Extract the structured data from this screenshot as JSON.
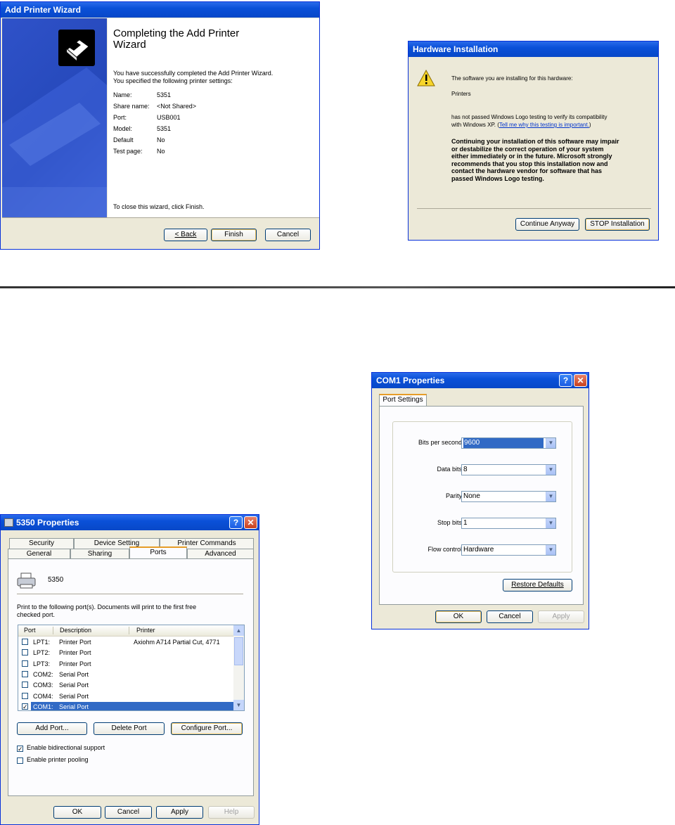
{
  "wizard": {
    "title": "Add Printer Wizard",
    "heading": "Completing the Add Printer Wizard",
    "intro1": "You have successfully completed the Add Printer Wizard.",
    "intro2": "You specified the following printer settings:",
    "settings": [
      {
        "label": "Name:",
        "value": "5351"
      },
      {
        "label": "Share name:",
        "value": "<Not Shared>"
      },
      {
        "label": "Port:",
        "value": "USB001"
      },
      {
        "label": "Model:",
        "value": "5351"
      },
      {
        "label": "Default",
        "value": "No"
      },
      {
        "label": "Test page:",
        "value": "No"
      }
    ],
    "close_text": "To close this wizard, click Finish.",
    "back": "< Back",
    "finish": "Finish",
    "cancel": "Cancel"
  },
  "hw": {
    "title": "Hardware Installation",
    "line1": "The software you are installing for this hardware:",
    "line2": "Printers",
    "line3": "has not passed Windows Logo testing to verify its compatibility",
    "line4_pre": "with Windows XP. (",
    "line4_link": "Tell me why this testing is important.",
    "line4_post": ")",
    "warn": [
      "Continuing your installation of this software may impair",
      "or destabilize the correct operation of your system",
      "either immediately or in the future. Microsoft strongly",
      "recommends that you stop this installation now and",
      "contact the hardware vendor for software that has",
      "passed Windows Logo testing."
    ],
    "continue": "Continue Anyway",
    "stop": "STOP Installation"
  },
  "props": {
    "title": "5350 Properties",
    "tabs_row1": [
      "Security",
      "Device Setting",
      "Printer Commands"
    ],
    "tabs_row2": [
      "General",
      "Sharing",
      "Ports",
      "Advanced"
    ],
    "printer_name": "5350",
    "instr1": "Print to the following port(s). Documents will print to the first free",
    "instr2": "checked port.",
    "cols": [
      "Port",
      "Description",
      "Printer"
    ],
    "ports": [
      {
        "port": "LPT1:",
        "desc": "Printer Port",
        "printer": "Axiohm A714 Partial Cut, 4771"
      },
      {
        "port": "LPT2:",
        "desc": "Printer Port",
        "printer": ""
      },
      {
        "port": "LPT3:",
        "desc": "Printer Port",
        "printer": ""
      },
      {
        "port": "COM2:",
        "desc": "Serial Port",
        "printer": ""
      },
      {
        "port": "COM3:",
        "desc": "Serial Port",
        "printer": ""
      },
      {
        "port": "COM4:",
        "desc": "Serial Port",
        "printer": ""
      },
      {
        "port": "COM1:",
        "desc": "Serial Port",
        "printer": ""
      }
    ],
    "add_port": "Add Port...",
    "delete_port": "Delete Port",
    "configure_port": "Configure Port...",
    "bidi": "Enable bidirectional support",
    "pooling": "Enable printer pooling",
    "ok": "OK",
    "cancel": "Cancel",
    "apply": "Apply",
    "help": "Help"
  },
  "com": {
    "title": "COM1 Properties",
    "tab": "Port Settings",
    "fields": [
      {
        "label": "Bits per second",
        "value": "9600"
      },
      {
        "label": "Data bits",
        "value": "8"
      },
      {
        "label": "Parity",
        "value": "None"
      },
      {
        "label": "Stop bits",
        "value": "1"
      },
      {
        "label": "Flow control",
        "value": "Hardware"
      }
    ],
    "restore": "Restore Defaults",
    "ok": "OK",
    "cancel": "Cancel",
    "apply": "Apply"
  }
}
